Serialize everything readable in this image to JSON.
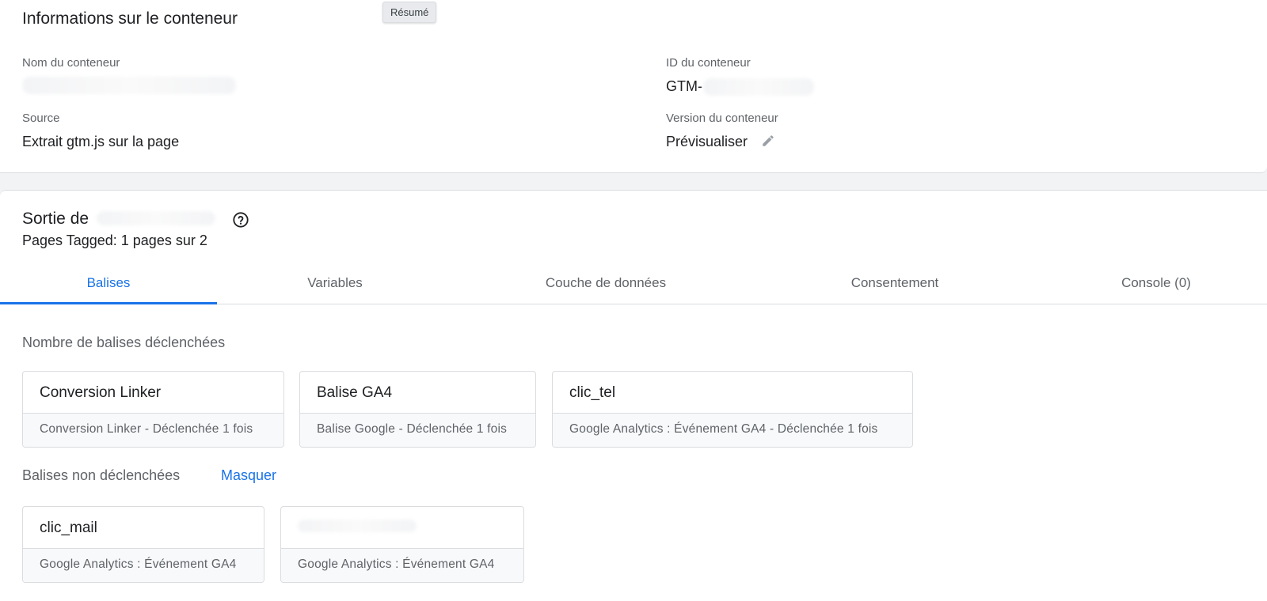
{
  "tooltip": "Résumé",
  "container_info": {
    "title": "Informations sur le conteneur",
    "name_label": "Nom du conteneur",
    "id_label": "ID du conteneur",
    "id_value": "GTM-",
    "source_label": "Source",
    "source_value": "Extrait gtm.js sur la page",
    "version_label": "Version du conteneur",
    "version_value": "Prévisualiser"
  },
  "output": {
    "title_prefix": "Sortie de",
    "pages_tagged": "Pages Tagged: 1 pages sur 2"
  },
  "tabs": [
    {
      "label": "Balises",
      "active": true
    },
    {
      "label": "Variables",
      "active": false
    },
    {
      "label": "Couche de données",
      "active": false
    },
    {
      "label": "Consentement",
      "active": false
    },
    {
      "label": "Console (0)",
      "active": false
    }
  ],
  "fired": {
    "heading": "Nombre de balises déclenchées",
    "tags": [
      {
        "name": "Conversion Linker",
        "detail": "Conversion Linker - Déclenchée 1 fois"
      },
      {
        "name": "Balise GA4",
        "detail": "Balise Google - Déclenchée 1 fois"
      },
      {
        "name": "clic_tel",
        "detail": "Google Analytics : Événement GA4 - Déclenchée 1 fois"
      }
    ]
  },
  "not_fired": {
    "heading": "Balises non déclenchées",
    "toggle_label": "Masquer",
    "tags": [
      {
        "name": "clic_mail",
        "detail": "Google Analytics : Événement GA4"
      },
      {
        "name": "",
        "detail": "Google Analytics : Événement GA4"
      }
    ]
  },
  "colors": {
    "accent": "#1a73e8",
    "text_primary": "#202124",
    "text_secondary": "#5f6368",
    "border": "#dadce0",
    "page_bg": "#f1f3f4"
  },
  "icons": [
    "pencil-icon",
    "help-circle-icon"
  ]
}
